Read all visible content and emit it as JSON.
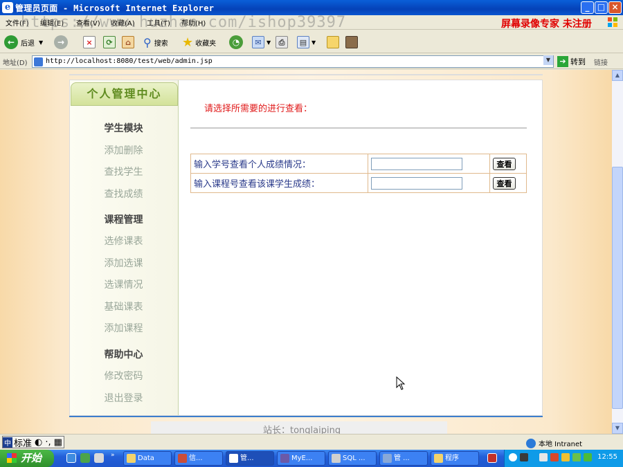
{
  "window": {
    "title": "管理员页面 - Microsoft Internet Explorer",
    "minimize": "_",
    "maximize": "□",
    "close": "×"
  },
  "menubar": {
    "items": [
      "文件(F)",
      "编辑(E)",
      "查看(V)",
      "收藏(A)",
      "工具(T)",
      "帮助(H)"
    ],
    "watermark": "https://www.huzhan.com/ishop39397",
    "registration": "屏幕录像专家 未注册"
  },
  "toolbar": {
    "back_label": "后退",
    "search_label": "搜索",
    "favorites_label": "收藏夹"
  },
  "address": {
    "label": "地址(D)",
    "url": "http://localhost:8080/test/web/admin.jsp",
    "go_label": "转到",
    "links_label": "链接"
  },
  "sidebar": {
    "header": "个人管理中心",
    "sections": [
      {
        "title": "学生模块",
        "items": [
          "添加删除",
          "查找学生",
          "查找成绩"
        ]
      },
      {
        "title": "课程管理",
        "items": [
          "选修课表",
          "添加选课",
          "选课情况",
          "基础课表",
          "添加课程"
        ]
      },
      {
        "title": "帮助中心",
        "items": [
          "修改密码",
          "退出登录"
        ]
      }
    ]
  },
  "main": {
    "prompt": "请选择所需要的进行查看：",
    "rows": [
      {
        "label": "输入学号查看个人成绩情况：",
        "button": "查看"
      },
      {
        "label": "输入课程号查看该课学生成绩：",
        "button": "查看"
      }
    ]
  },
  "footer": {
    "text": "站长：tonglaiping"
  },
  "statusbar": {
    "ime": [
      "标准",
      "◐",
      "·,",
      "▦"
    ],
    "zone": "本地 Intranet"
  },
  "taskbar": {
    "start": "开始",
    "tasks": [
      "Data",
      "信...",
      "管...",
      "MyE...",
      "SQL ...",
      "管 ...",
      "程序"
    ],
    "clock": "12:55"
  }
}
